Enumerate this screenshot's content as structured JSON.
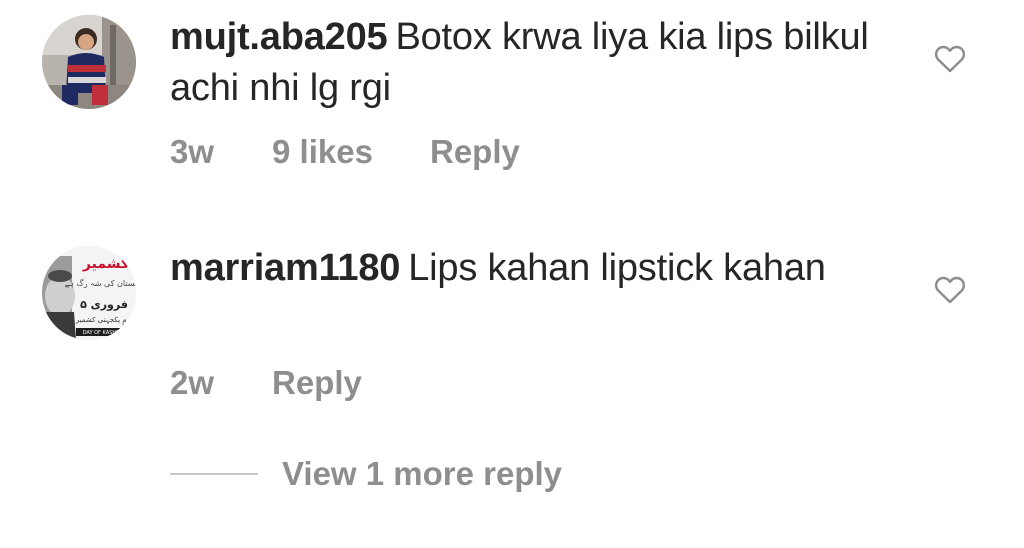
{
  "comments": [
    {
      "username": "mujt.aba205",
      "text": "Botox krwa liya kia lips bilkul achi nhi lg rgi",
      "time": "3w",
      "likes": "9 likes",
      "reply": "Reply",
      "like_icon": "heart-outline-icon"
    },
    {
      "username": "marriam1180",
      "text": "Lips kahan lipstick kahan",
      "time": "2w",
      "reply": "Reply",
      "like_icon": "heart-outline-icon",
      "avatar_text": {
        "top": "کشمیر",
        "middle": "پاکستان کی شہ رگ ہے",
        "date": "۵ فروری",
        "bottom": "یومِ یکجہتی کشمیر",
        "banner": "DAY OF KASHMIR"
      }
    }
  ],
  "view_more": {
    "label": "View 1 more reply"
  },
  "colors": {
    "text": "#262626",
    "secondary": "#8e8e8e",
    "divider": "#c7c7c7"
  }
}
